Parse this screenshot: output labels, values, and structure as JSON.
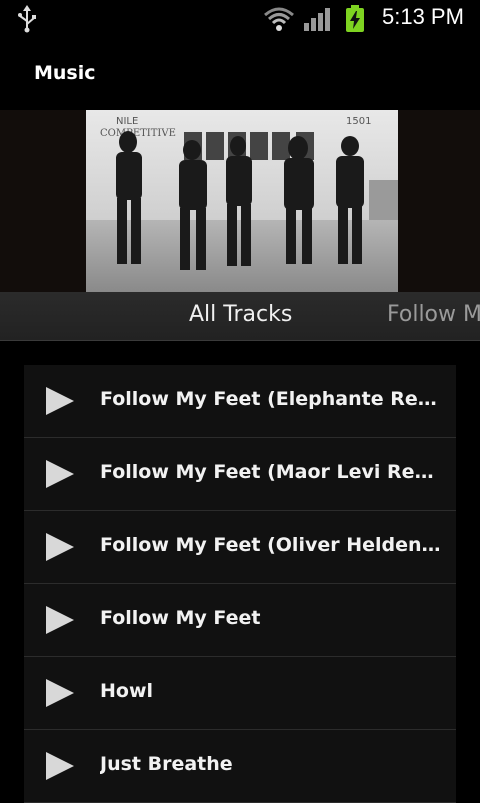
{
  "status_bar": {
    "time": "5:13 PM",
    "icons": [
      "usb-icon",
      "wifi-icon",
      "signal-icon",
      "battery-charging-icon"
    ],
    "battery_color": "#7ed321"
  },
  "action_bar": {
    "title": "Music"
  },
  "header_image": {
    "sign_left_line1": "NILE",
    "sign_left_line2": "COMPETITIVE",
    "sign_right_line1": "1501"
  },
  "tabs": [
    {
      "label": "All Tracks",
      "active": true
    },
    {
      "label": "Follow M",
      "active": false
    }
  ],
  "tracks": [
    {
      "title": "Follow My Feet (Elephante Remix)"
    },
    {
      "title": "Follow My Feet (Maor Levi Remix)"
    },
    {
      "title": "Follow My Feet (Oliver Heldens Remix)"
    },
    {
      "title": "Follow My Feet"
    },
    {
      "title": "Howl"
    },
    {
      "title": "Just Breathe"
    }
  ],
  "colors": {
    "background": "#000000",
    "list_row": "#111111",
    "text": "#f2f2f2",
    "play_icon": "#d8d8d8"
  }
}
